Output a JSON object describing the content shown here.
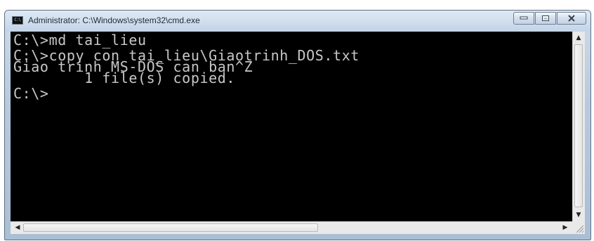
{
  "window": {
    "title": "Administrator: C:\\Windows\\system32\\cmd.exe",
    "icon_text": "C:\\"
  },
  "caption_buttons": {
    "minimize_icon": "minimize-icon",
    "maximize_icon": "maximize-icon",
    "close_icon": "close-icon"
  },
  "console": {
    "lines": [
      "C:\\>md tai_lieu",
      "",
      "C:\\>copy con tai_lieu\\Giaotrinh_DOS.txt",
      "Giao trinh MS-DOS can ban^Z",
      "        1 file(s) copied.",
      "",
      "C:\\>"
    ],
    "text_color": "#c8c8c8",
    "background": "#000000"
  },
  "scrollbars": {
    "up_arrow": "▲",
    "down_arrow": "▼",
    "left_arrow": "◀",
    "right_arrow": "▶"
  }
}
